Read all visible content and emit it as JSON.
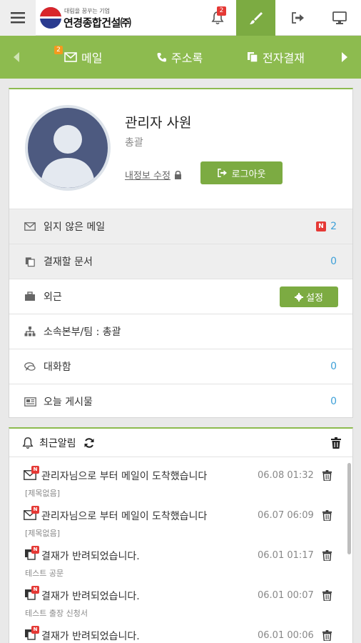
{
  "colors": {
    "brand_green": "#8dbb4f",
    "button_green": "#7cab42",
    "badge_red": "#e53935",
    "badge_orange": "#f39a1e",
    "link_blue": "#3ea0d8"
  },
  "header": {
    "logo_slogan": "대림을 꿈꾸는 기업",
    "logo_name": "연경종합건설㈜",
    "bell_count": "2",
    "icons": [
      "menu-icon",
      "bell-icon",
      "brush-icon",
      "sign-out-icon",
      "desktop-icon"
    ]
  },
  "nav": {
    "items": [
      {
        "label": "메일",
        "icon": "envelope-icon",
        "badge": "2"
      },
      {
        "label": "주소록",
        "icon": "phone-icon"
      },
      {
        "label": "전자결재",
        "icon": "documents-icon"
      }
    ]
  },
  "profile": {
    "name": "관리자 사원",
    "department": "총괄",
    "edit_link": "내정보 수정",
    "logout_label": "로그아웃",
    "rows": [
      {
        "label": "읽지 않은 메일",
        "icon": "envelope-icon",
        "badge": "N",
        "value": "2"
      },
      {
        "label": "결재할 문서",
        "icon": "documents-icon",
        "value": "0"
      },
      {
        "label": "외근",
        "icon": "briefcase-icon",
        "button": "설정"
      },
      {
        "label": "소속본부/팀 : 총괄",
        "icon": "sitemap-icon"
      },
      {
        "label": "대화함",
        "icon": "chat-icon",
        "value": "0"
      },
      {
        "label": "오늘 게시물",
        "icon": "newspaper-icon",
        "value": "0"
      }
    ]
  },
  "notifications": {
    "title": "최근알림",
    "items": [
      {
        "type": "mail",
        "title": "관리자님으로 부터 메일이 도착했습니다",
        "subtitle": "[제목없음]",
        "time": "06.08 01:32"
      },
      {
        "type": "mail",
        "title": "관리자님으로 부터 메일이 도착했습니다",
        "subtitle": "[제목없음]",
        "time": "06.07 06:09"
      },
      {
        "type": "doc",
        "title": "결재가 반려되었습니다.",
        "subtitle": "테스트 공문",
        "time": "06.01 01:17"
      },
      {
        "type": "doc",
        "title": "결재가 반려되었습니다.",
        "subtitle": "테스트 출장 신청서",
        "time": "06.01 00:07"
      },
      {
        "type": "doc",
        "title": "결재가 반려되었습니다.",
        "subtitle": "",
        "time": "06.01 00:06"
      }
    ]
  }
}
